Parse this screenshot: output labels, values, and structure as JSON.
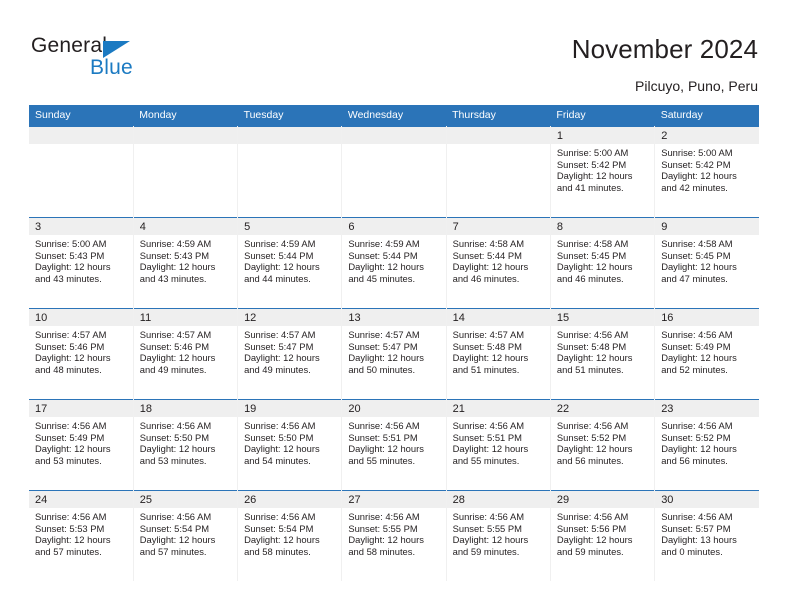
{
  "brand": {
    "name_part1": "General",
    "name_part2": "Blue",
    "triangle_icon": "blue-triangle-icon",
    "accent_color": "#1b7ac2"
  },
  "header": {
    "title": "November 2024",
    "subtitle": "Pilcuyo, Puno, Peru",
    "header_bg_color": "#2b74b8",
    "daynum_band_color": "#efefef"
  },
  "weekday_headers": [
    "Sunday",
    "Monday",
    "Tuesday",
    "Wednesday",
    "Thursday",
    "Friday",
    "Saturday"
  ],
  "labels": {
    "sunrise": "Sunrise:",
    "sunset": "Sunset:",
    "daylight": "Daylight:"
  },
  "weeks": [
    [
      {
        "day": "",
        "empty": true
      },
      {
        "day": "",
        "empty": true
      },
      {
        "day": "",
        "empty": true
      },
      {
        "day": "",
        "empty": true
      },
      {
        "day": "",
        "empty": true
      },
      {
        "day": "1",
        "sunrise": "Sunrise: 5:00 AM",
        "sunset": "Sunset: 5:42 PM",
        "daylight_l1": "Daylight: 12 hours",
        "daylight_l2": "and 41 minutes."
      },
      {
        "day": "2",
        "sunrise": "Sunrise: 5:00 AM",
        "sunset": "Sunset: 5:42 PM",
        "daylight_l1": "Daylight: 12 hours",
        "daylight_l2": "and 42 minutes."
      }
    ],
    [
      {
        "day": "3",
        "sunrise": "Sunrise: 5:00 AM",
        "sunset": "Sunset: 5:43 PM",
        "daylight_l1": "Daylight: 12 hours",
        "daylight_l2": "and 43 minutes."
      },
      {
        "day": "4",
        "sunrise": "Sunrise: 4:59 AM",
        "sunset": "Sunset: 5:43 PM",
        "daylight_l1": "Daylight: 12 hours",
        "daylight_l2": "and 43 minutes."
      },
      {
        "day": "5",
        "sunrise": "Sunrise: 4:59 AM",
        "sunset": "Sunset: 5:44 PM",
        "daylight_l1": "Daylight: 12 hours",
        "daylight_l2": "and 44 minutes."
      },
      {
        "day": "6",
        "sunrise": "Sunrise: 4:59 AM",
        "sunset": "Sunset: 5:44 PM",
        "daylight_l1": "Daylight: 12 hours",
        "daylight_l2": "and 45 minutes."
      },
      {
        "day": "7",
        "sunrise": "Sunrise: 4:58 AM",
        "sunset": "Sunset: 5:44 PM",
        "daylight_l1": "Daylight: 12 hours",
        "daylight_l2": "and 46 minutes."
      },
      {
        "day": "8",
        "sunrise": "Sunrise: 4:58 AM",
        "sunset": "Sunset: 5:45 PM",
        "daylight_l1": "Daylight: 12 hours",
        "daylight_l2": "and 46 minutes."
      },
      {
        "day": "9",
        "sunrise": "Sunrise: 4:58 AM",
        "sunset": "Sunset: 5:45 PM",
        "daylight_l1": "Daylight: 12 hours",
        "daylight_l2": "and 47 minutes."
      }
    ],
    [
      {
        "day": "10",
        "sunrise": "Sunrise: 4:57 AM",
        "sunset": "Sunset: 5:46 PM",
        "daylight_l1": "Daylight: 12 hours",
        "daylight_l2": "and 48 minutes."
      },
      {
        "day": "11",
        "sunrise": "Sunrise: 4:57 AM",
        "sunset": "Sunset: 5:46 PM",
        "daylight_l1": "Daylight: 12 hours",
        "daylight_l2": "and 49 minutes."
      },
      {
        "day": "12",
        "sunrise": "Sunrise: 4:57 AM",
        "sunset": "Sunset: 5:47 PM",
        "daylight_l1": "Daylight: 12 hours",
        "daylight_l2": "and 49 minutes."
      },
      {
        "day": "13",
        "sunrise": "Sunrise: 4:57 AM",
        "sunset": "Sunset: 5:47 PM",
        "daylight_l1": "Daylight: 12 hours",
        "daylight_l2": "and 50 minutes."
      },
      {
        "day": "14",
        "sunrise": "Sunrise: 4:57 AM",
        "sunset": "Sunset: 5:48 PM",
        "daylight_l1": "Daylight: 12 hours",
        "daylight_l2": "and 51 minutes."
      },
      {
        "day": "15",
        "sunrise": "Sunrise: 4:56 AM",
        "sunset": "Sunset: 5:48 PM",
        "daylight_l1": "Daylight: 12 hours",
        "daylight_l2": "and 51 minutes."
      },
      {
        "day": "16",
        "sunrise": "Sunrise: 4:56 AM",
        "sunset": "Sunset: 5:49 PM",
        "daylight_l1": "Daylight: 12 hours",
        "daylight_l2": "and 52 minutes."
      }
    ],
    [
      {
        "day": "17",
        "sunrise": "Sunrise: 4:56 AM",
        "sunset": "Sunset: 5:49 PM",
        "daylight_l1": "Daylight: 12 hours",
        "daylight_l2": "and 53 minutes."
      },
      {
        "day": "18",
        "sunrise": "Sunrise: 4:56 AM",
        "sunset": "Sunset: 5:50 PM",
        "daylight_l1": "Daylight: 12 hours",
        "daylight_l2": "and 53 minutes."
      },
      {
        "day": "19",
        "sunrise": "Sunrise: 4:56 AM",
        "sunset": "Sunset: 5:50 PM",
        "daylight_l1": "Daylight: 12 hours",
        "daylight_l2": "and 54 minutes."
      },
      {
        "day": "20",
        "sunrise": "Sunrise: 4:56 AM",
        "sunset": "Sunset: 5:51 PM",
        "daylight_l1": "Daylight: 12 hours",
        "daylight_l2": "and 55 minutes."
      },
      {
        "day": "21",
        "sunrise": "Sunrise: 4:56 AM",
        "sunset": "Sunset: 5:51 PM",
        "daylight_l1": "Daylight: 12 hours",
        "daylight_l2": "and 55 minutes."
      },
      {
        "day": "22",
        "sunrise": "Sunrise: 4:56 AM",
        "sunset": "Sunset: 5:52 PM",
        "daylight_l1": "Daylight: 12 hours",
        "daylight_l2": "and 56 minutes."
      },
      {
        "day": "23",
        "sunrise": "Sunrise: 4:56 AM",
        "sunset": "Sunset: 5:52 PM",
        "daylight_l1": "Daylight: 12 hours",
        "daylight_l2": "and 56 minutes."
      }
    ],
    [
      {
        "day": "24",
        "sunrise": "Sunrise: 4:56 AM",
        "sunset": "Sunset: 5:53 PM",
        "daylight_l1": "Daylight: 12 hours",
        "daylight_l2": "and 57 minutes."
      },
      {
        "day": "25",
        "sunrise": "Sunrise: 4:56 AM",
        "sunset": "Sunset: 5:54 PM",
        "daylight_l1": "Daylight: 12 hours",
        "daylight_l2": "and 57 minutes."
      },
      {
        "day": "26",
        "sunrise": "Sunrise: 4:56 AM",
        "sunset": "Sunset: 5:54 PM",
        "daylight_l1": "Daylight: 12 hours",
        "daylight_l2": "and 58 minutes."
      },
      {
        "day": "27",
        "sunrise": "Sunrise: 4:56 AM",
        "sunset": "Sunset: 5:55 PM",
        "daylight_l1": "Daylight: 12 hours",
        "daylight_l2": "and 58 minutes."
      },
      {
        "day": "28",
        "sunrise": "Sunrise: 4:56 AM",
        "sunset": "Sunset: 5:55 PM",
        "daylight_l1": "Daylight: 12 hours",
        "daylight_l2": "and 59 minutes."
      },
      {
        "day": "29",
        "sunrise": "Sunrise: 4:56 AM",
        "sunset": "Sunset: 5:56 PM",
        "daylight_l1": "Daylight: 12 hours",
        "daylight_l2": "and 59 minutes."
      },
      {
        "day": "30",
        "sunrise": "Sunrise: 4:56 AM",
        "sunset": "Sunset: 5:57 PM",
        "daylight_l1": "Daylight: 13 hours",
        "daylight_l2": "and 0 minutes."
      }
    ]
  ]
}
